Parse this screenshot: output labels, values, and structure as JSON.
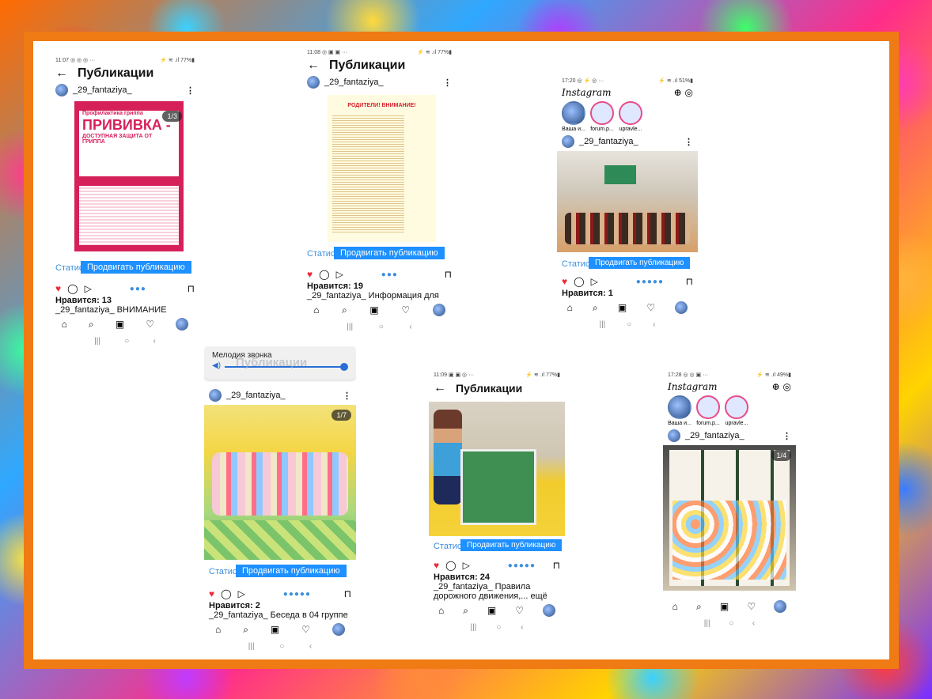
{
  "common": {
    "title": "Публикации",
    "username": "_29_fantaziya_",
    "stat_label": "Статис",
    "promote_label": "Продвигать публикацию",
    "instagram": "Instagram",
    "home_icon": "home-icon",
    "search_icon": "search-icon",
    "reels_icon": "reels-icon",
    "heart_icon": "heart-icon",
    "profile_icon": "profile-icon"
  },
  "shot1": {
    "status_time": "11:07 ◎ ◎ ◎ ···",
    "status_right": "⚡ ≋ .ıl 77%▮",
    "poster_tag": "Профилактика гриппа",
    "poster_title": "ПРИВИВКА -",
    "poster_sub": "ДОСТУПНАЯ ЗАЩИТА ОТ ГРИППА",
    "badge": "1/3",
    "likes": "Нравится: 13",
    "caption": "_29_fantaziya_ ВНИМАНИЕ"
  },
  "shot2": {
    "status_time": "11:08 ◎ ▣ ▣ ···",
    "status_right": "⚡ ≋ .ıl 77%▮",
    "poster_title": "РОДИТЕЛИ! ВНИМАНИЕ!",
    "likes": "Нравится: 19",
    "caption": "_29_fantaziya_ Информация для"
  },
  "shot3": {
    "status_time": "17:20 ◎ ⚡ ◎ ···",
    "status_right": "⚡ ≋ .ıl 51%▮",
    "stories": [
      "Ваша и...",
      "forum.p...",
      "upravle..."
    ],
    "likes": "Нравится: 1"
  },
  "shot4": {
    "ringtone_label": "Мелодия звонка",
    "ghost_title": "Публикации",
    "badge": "1/7",
    "likes": "Нравится: 2",
    "caption": "_29_fantaziya_ Беседа в 04 группе"
  },
  "shot5": {
    "status_time": "11:09 ▣ ▣ ◎ ···",
    "status_right": "⚡ ≋ .ıl 77%▮",
    "likes": "Нравится: 24",
    "caption1": "_29_fantaziya_ Правила",
    "caption2": "дорожного движения,... ещё"
  },
  "shot6": {
    "status_time": "17:28 ◎ ◎ ▣ ···",
    "status_right": "⚡ ≋ .ıl 49%▮",
    "stories": [
      "Ваша и...",
      "forum.p...",
      "upravle..."
    ],
    "badge": "1/4"
  }
}
